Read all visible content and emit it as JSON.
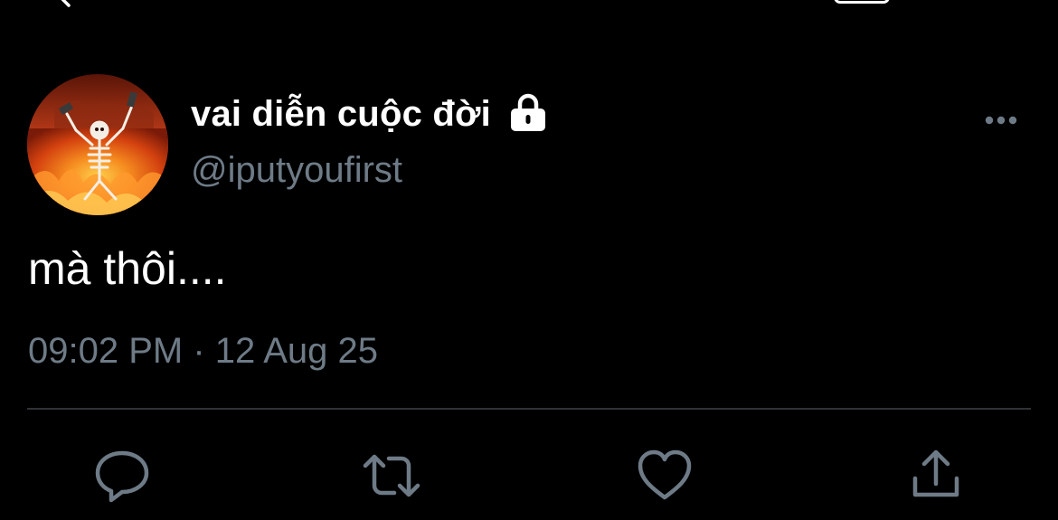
{
  "tweet": {
    "display_name": "vai diễn cuộc đời",
    "handle": "@iputyoufirst",
    "text": "mà thôi....",
    "time": "09:02 PM",
    "separator": "·",
    "date": "12 Aug 25",
    "locked_account": true
  },
  "icons": {
    "back": "chevron-left-icon",
    "lock": "lock-icon",
    "more": "more-dots-icon",
    "reply": "reply-icon",
    "retweet": "retweet-icon",
    "like": "heart-icon",
    "share": "share-icon"
  },
  "colors": {
    "background": "#000000",
    "primary_text": "#ffffff",
    "secondary_text": "#6e7b87",
    "divider": "#2f3336",
    "icon": "#6e7b87"
  }
}
